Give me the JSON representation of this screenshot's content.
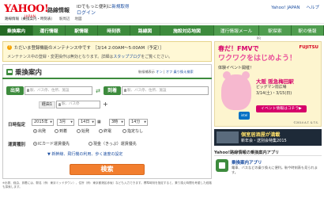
{
  "header": {
    "logo_text": "YAHOO!",
    "logo_sub": "JAPAN",
    "service_title": "路線情報",
    "promo_prefix": "IDでもっと便利に",
    "promo_link": "新規取得",
    "login": "ログイン",
    "links": [
      "Yahoo! JAPAN",
      "ヘルプ"
    ],
    "sub_tabs": [
      "路線情報（乗換案内・時刻表）",
      "駅周辺",
      "地図"
    ]
  },
  "nav": {
    "items": [
      "乗換案内",
      "運行情報",
      "駅情報",
      "時刻表",
      "路線図",
      "施設対応地図",
      "運行情報メール",
      "駅探索",
      "駅の情報"
    ]
  },
  "pr_label": "PR",
  "notice": {
    "line1": "ただいま登録機能のメンテナンス中です　［3/14 2:00AM〜5:00AM（予定）］",
    "line2_prefix": "メンテナンス中の登録・変更操作は無効となります。詳細は",
    "line2_link": "スタップブログ",
    "line2_suffix": "をご覧ください。"
  },
  "search": {
    "title": "乗換案内",
    "help_prefix": "駅候補表示",
    "help_on": "オン",
    "help_off": "オフ",
    "help_link": "乗り換え検索",
    "from_label": "出発",
    "to_label": "到着",
    "placeholder": "駅、バス停、住所、施設",
    "via_label": "経由1",
    "via_placeholder": "駅、バス停",
    "datetime_label": "日時指定",
    "year": "2015年",
    "month": "3月",
    "day": "14日",
    "hour": "3時",
    "minute": "14分",
    "year_unit": "",
    "radio_options": [
      "出発",
      "到着",
      "始発",
      "終電",
      "指定なし"
    ],
    "fare_label": "運賃種別",
    "fare_options": [
      "ICカード運賃優先",
      "現金（きっぷ）運賃優先"
    ],
    "check_line": "▼ 新幹線、飛行機の利用、歩く速度の設定",
    "submit": "検索",
    "footnote": "※出発、経由、到着には、駅名（例：東京ミッドタウン）、住所（例：東京都港区赤坂）なども入力できます。標準時刻を指定すると、乗り換え時間を考慮した経路も探索します。"
  },
  "ad1": {
    "line1": "春だ！FMVで",
    "line2": "ワクワクをはじめよう！",
    "brand": "FUJITSU",
    "sub": "体験イベント開催！",
    "venue": "大阪 阪急梅田駅",
    "venue2": "ビッグマン前広場",
    "date": "3/14(土)・3/15(日)",
    "button": "イベント情報はコチラ▶",
    "intel": "intel",
    "copyright": "©2014 A.T. & T.S."
  },
  "ad2": {
    "line1": "個室居酒屋が満載",
    "line2": "新年会・送別会特集2015"
  },
  "app": {
    "section_title": "Yahoo!路線情報の乗換案内アプリ",
    "name": "乗換案内アプリ",
    "desc": "電車、バスなどの乗り換えに便利。駅や時刻表も見られます。"
  },
  "colors": {
    "brand_green": "#3d8b3d",
    "search_button": "#f27e2e",
    "yahoo_red": "#e60012",
    "link_blue": "#1e50a2"
  }
}
